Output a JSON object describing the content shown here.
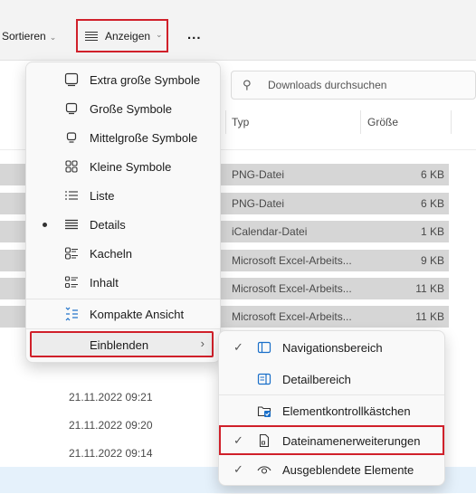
{
  "toolbar": {
    "sort_label": "Sortieren",
    "view_label": "Anzeigen",
    "more_label": "..."
  },
  "search": {
    "placeholder": "Downloads durchsuchen"
  },
  "columns": {
    "type": "Typ",
    "size": "Größe"
  },
  "files": [
    {
      "type": "PNG-Datei",
      "size": "6 KB"
    },
    {
      "type": "PNG-Datei",
      "size": "6 KB"
    },
    {
      "type": "iCalendar-Datei",
      "size": "1 KB"
    },
    {
      "type": "Microsoft Excel-Arbeits...",
      "size": "9 KB"
    },
    {
      "type": "Microsoft Excel-Arbeits...",
      "size": "11 KB"
    },
    {
      "type": "Microsoft Excel-Arbeits...",
      "size": "11 KB"
    }
  ],
  "dates": [
    "21.11.2022 09:21",
    "21.11.2022 09:20",
    "21.11.2022 09:14"
  ],
  "view_menu": {
    "items": [
      {
        "label": "Extra große Symbole",
        "icon": "monitor-icon"
      },
      {
        "label": "Große Symbole",
        "icon": "monitor-icon"
      },
      {
        "label": "Mittelgroße Symbole",
        "icon": "monitor-icon"
      },
      {
        "label": "Kleine Symbole",
        "icon": "grid-icon"
      },
      {
        "label": "Liste",
        "icon": "list-icon"
      },
      {
        "label": "Details",
        "icon": "details-icon",
        "selected": true
      },
      {
        "label": "Kacheln",
        "icon": "tiles-icon"
      },
      {
        "label": "Inhalt",
        "icon": "content-icon"
      }
    ],
    "compact": {
      "label": "Kompakte Ansicht",
      "icon": "compact-icon"
    },
    "show": {
      "label": "Einblenden"
    }
  },
  "show_menu": {
    "items": [
      {
        "label": "Navigationsbereich",
        "checked": true,
        "icon": "navigation-pane-icon"
      },
      {
        "label": "Detailbereich",
        "checked": false,
        "icon": "details-pane-icon"
      },
      {
        "label": "Elementkontrollkästchen",
        "checked": false,
        "icon": "checkbox-icon"
      },
      {
        "label": "Dateinamenerweiterungen",
        "checked": true,
        "icon": "file-icon"
      },
      {
        "label": "Ausgeblendete Elemente",
        "checked": true,
        "icon": "eye-icon"
      }
    ]
  }
}
